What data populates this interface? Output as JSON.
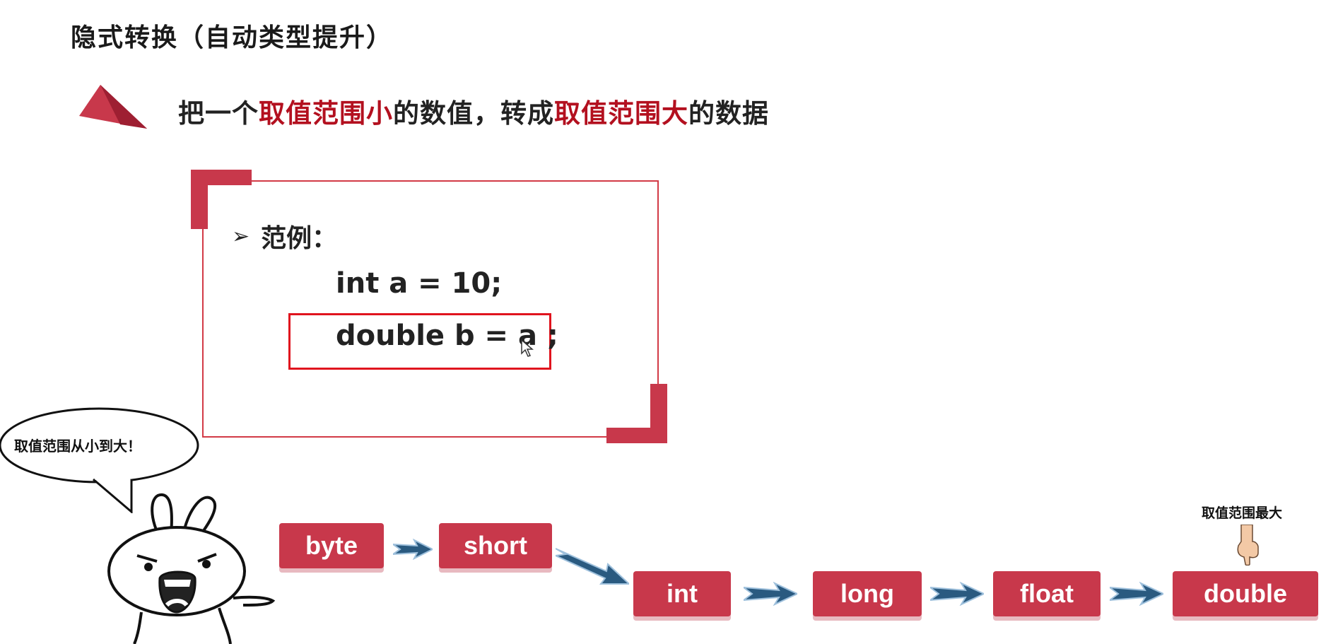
{
  "page": {
    "title": "隐式转换（自动类型提升）",
    "headline": {
      "part1": "把一个",
      "highlight1": "取值范围小",
      "part2": "的数值，转成",
      "highlight2": "取值范围大",
      "part3": "的数据"
    }
  },
  "example": {
    "label": "范例：",
    "line1": "int a = 10;",
    "line2": "double b = a ;"
  },
  "speech_bubble": "取值范围从小到大！",
  "flow": {
    "types": [
      "byte",
      "short",
      "int",
      "long",
      "float",
      "double"
    ],
    "max_label": "取值范围最大"
  },
  "colors": {
    "accent_red": "#c8384b",
    "headline_red": "#b3101f",
    "highlight_border": "#e0141e",
    "arrow_blue": "#2a5a80"
  }
}
